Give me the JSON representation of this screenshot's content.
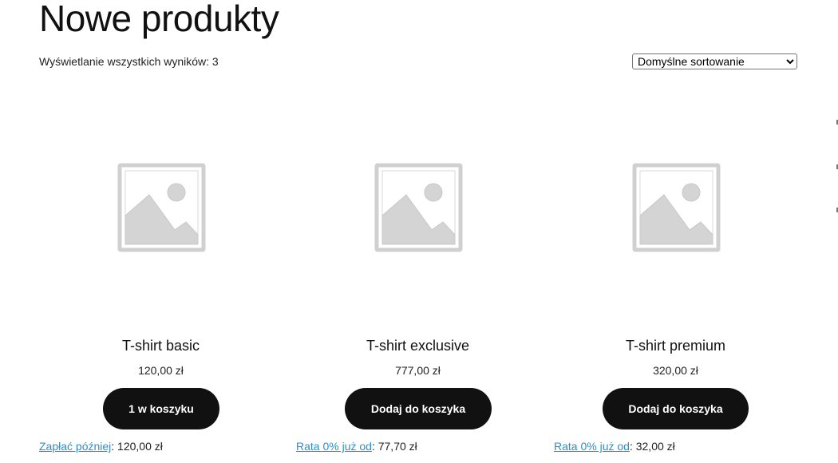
{
  "page": {
    "title": "Nowe produkty",
    "result_count": "Wyświetlanie wszystkich wyników: 3"
  },
  "sorting": {
    "selected": "Domyślne sortowanie"
  },
  "products": [
    {
      "name": "T-shirt basic",
      "price": "120,00 zł",
      "button_label": "1 w koszyku",
      "payment_link": "Zapłać później",
      "payment_amount": ": 120,00 zł",
      "image_icon": "placeholder-image-icon"
    },
    {
      "name": "T-shirt exclusive",
      "price": "777,00 zł",
      "button_label": "Dodaj do koszyka",
      "payment_link": "Rata 0% już od",
      "payment_amount": ": 77,70 zł",
      "image_icon": "placeholder-image-icon"
    },
    {
      "name": "T-shirt premium",
      "price": "320,00 zł",
      "button_label": "Dodaj do koszyka",
      "payment_link": "Rata 0% już od",
      "payment_amount": ": 32,00 zł",
      "image_icon": "placeholder-image-icon"
    }
  ],
  "colors": {
    "button_bg": "#111111",
    "button_text": "#ffffff",
    "link": "#2a8fd0",
    "placeholder": "#d4d4d4"
  }
}
